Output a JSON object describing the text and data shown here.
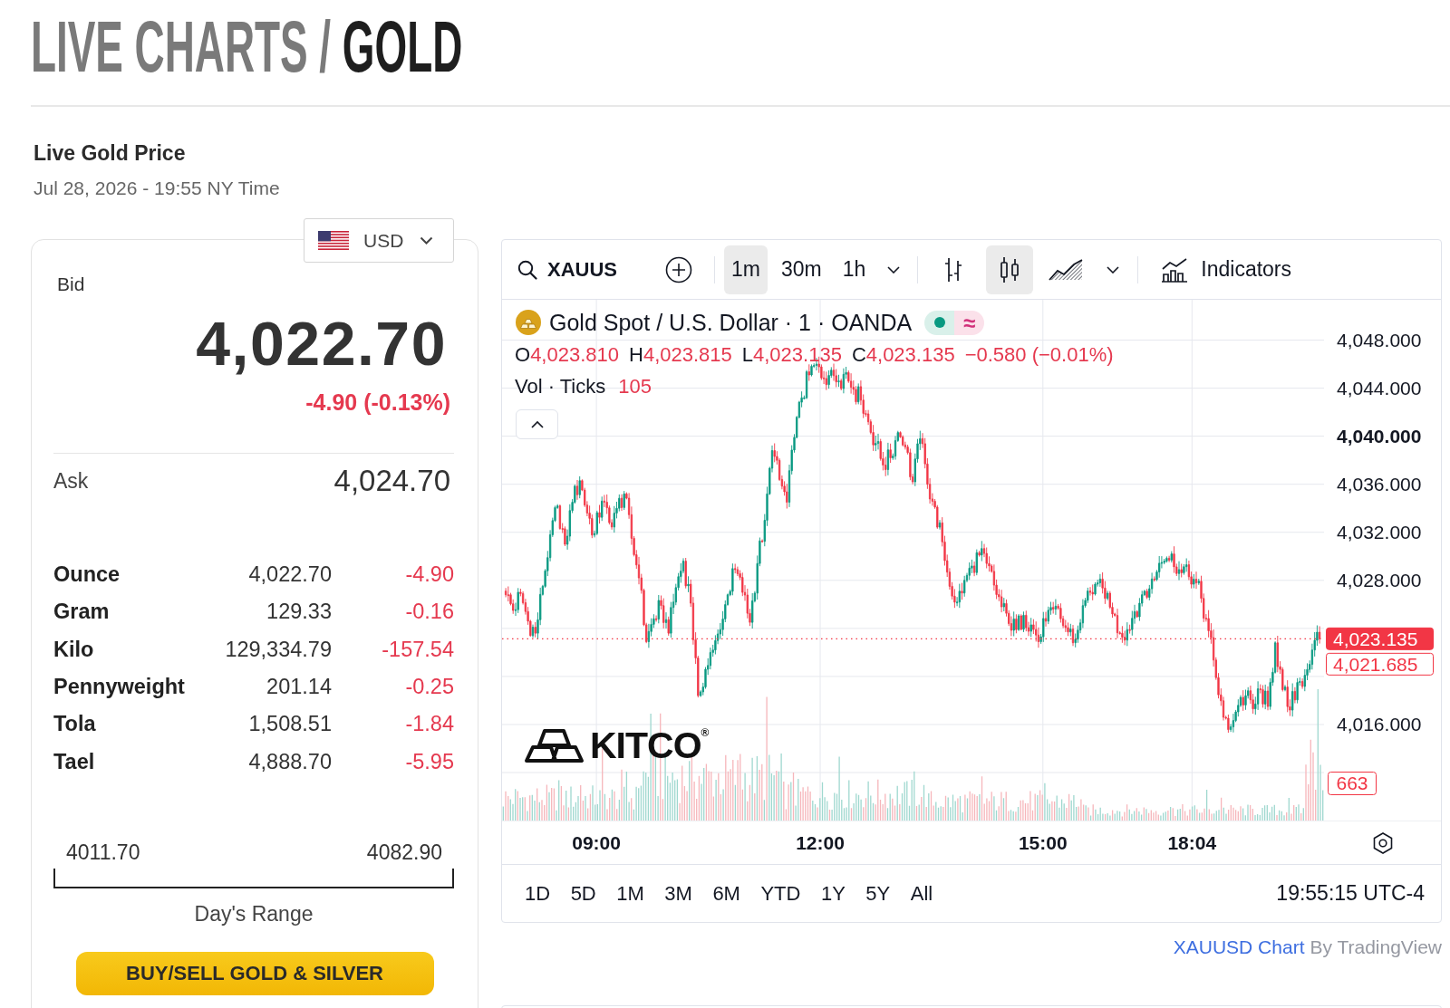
{
  "header": {
    "title_prefix": "LIVE CHARTS /",
    "title_main": "GOLD"
  },
  "price_panel": {
    "heading": "Live Gold Price",
    "timestamp": "Jul 28, 2026 - 19:55 NY Time",
    "currency": "USD",
    "bid_label": "Bid",
    "bid": "4,022.70",
    "change": "-4.90 (-0.13%)",
    "negative": true,
    "ask_label": "Ask",
    "ask": "4,024.70",
    "units": [
      {
        "name": "Ounce",
        "price": "4,022.70",
        "change": "-4.90",
        "negative": true
      },
      {
        "name": "Gram",
        "price": "129.33",
        "change": "-0.16",
        "negative": true
      },
      {
        "name": "Kilo",
        "price": "129,334.79",
        "change": "-157.54",
        "negative": true
      },
      {
        "name": "Pennyweight",
        "price": "201.14",
        "change": "-0.25",
        "negative": true
      },
      {
        "name": "Tola",
        "price": "1,508.51",
        "change": "-1.84",
        "negative": true
      },
      {
        "name": "Tael",
        "price": "4,888.70",
        "change": "-5.95",
        "negative": true
      }
    ],
    "day_range": {
      "low": "4011.70",
      "high": "4082.90",
      "label": "Day's Range"
    },
    "button": "BUY/SELL GOLD & SILVER"
  },
  "chart": {
    "toolbar": {
      "symbol": "XAUUS",
      "intervals": [
        {
          "label": "1m",
          "selected": true
        },
        {
          "label": "30m",
          "selected": false
        },
        {
          "label": "1h",
          "selected": false
        }
      ],
      "chart_styles": [
        {
          "kind": "bars",
          "selected": false
        },
        {
          "kind": "candles",
          "selected": true
        },
        {
          "kind": "area",
          "selected": false
        }
      ],
      "indicators": "Indicators"
    },
    "legend": {
      "title": "Gold Spot / U.S. Dollar · 1 · OANDA",
      "market_open": true,
      "badge_symbol": "≈",
      "ohlc": [
        {
          "label": "O",
          "value": "4,023.810"
        },
        {
          "label": "H",
          "value": "4,023.815"
        },
        {
          "label": "L",
          "value": "4,023.135"
        },
        {
          "label": "C",
          "value": "4,023.135"
        }
      ],
      "change": "−0.580 (−0.01%)",
      "negative": true,
      "volume_label": "Vol · Ticks",
      "volume_value": "105"
    },
    "price_axis": [
      {
        "label": "4,048.000",
        "emphasized": false
      },
      {
        "label": "4,044.000",
        "emphasized": false
      },
      {
        "label": "4,040.000",
        "emphasized": true
      },
      {
        "label": "4,036.000",
        "emphasized": false
      },
      {
        "label": "4,032.000",
        "emphasized": false
      },
      {
        "label": "4,028.000",
        "emphasized": false
      },
      {
        "label": "4,016.000",
        "emphasized": false
      }
    ],
    "price_badges": [
      {
        "label": "4,023.135",
        "filled": true
      },
      {
        "label": "4,021.685",
        "filled": false
      }
    ],
    "volume_badge": "663",
    "time_axis": [
      "09:00",
      "12:00",
      "15:00",
      "18:04"
    ],
    "logo": "KITCO$^{®}$",
    "ranges": [
      {
        "label": "1D",
        "selected": false
      },
      {
        "label": "5D",
        "selected": false
      },
      {
        "label": "1M",
        "selected": false
      },
      {
        "label": "3M",
        "selected": false
      },
      {
        "label": "6M",
        "selected": false
      },
      {
        "label": "YTD",
        "selected": false
      },
      {
        "label": "1Y",
        "selected": false
      },
      {
        "label": "5Y",
        "selected": false
      },
      {
        "label": "All",
        "selected": false
      }
    ],
    "clock": "19:55:15 UTC-4"
  },
  "attribution": {
    "link": "XAUUSD Chart",
    "text": "By TradingView"
  }
}
